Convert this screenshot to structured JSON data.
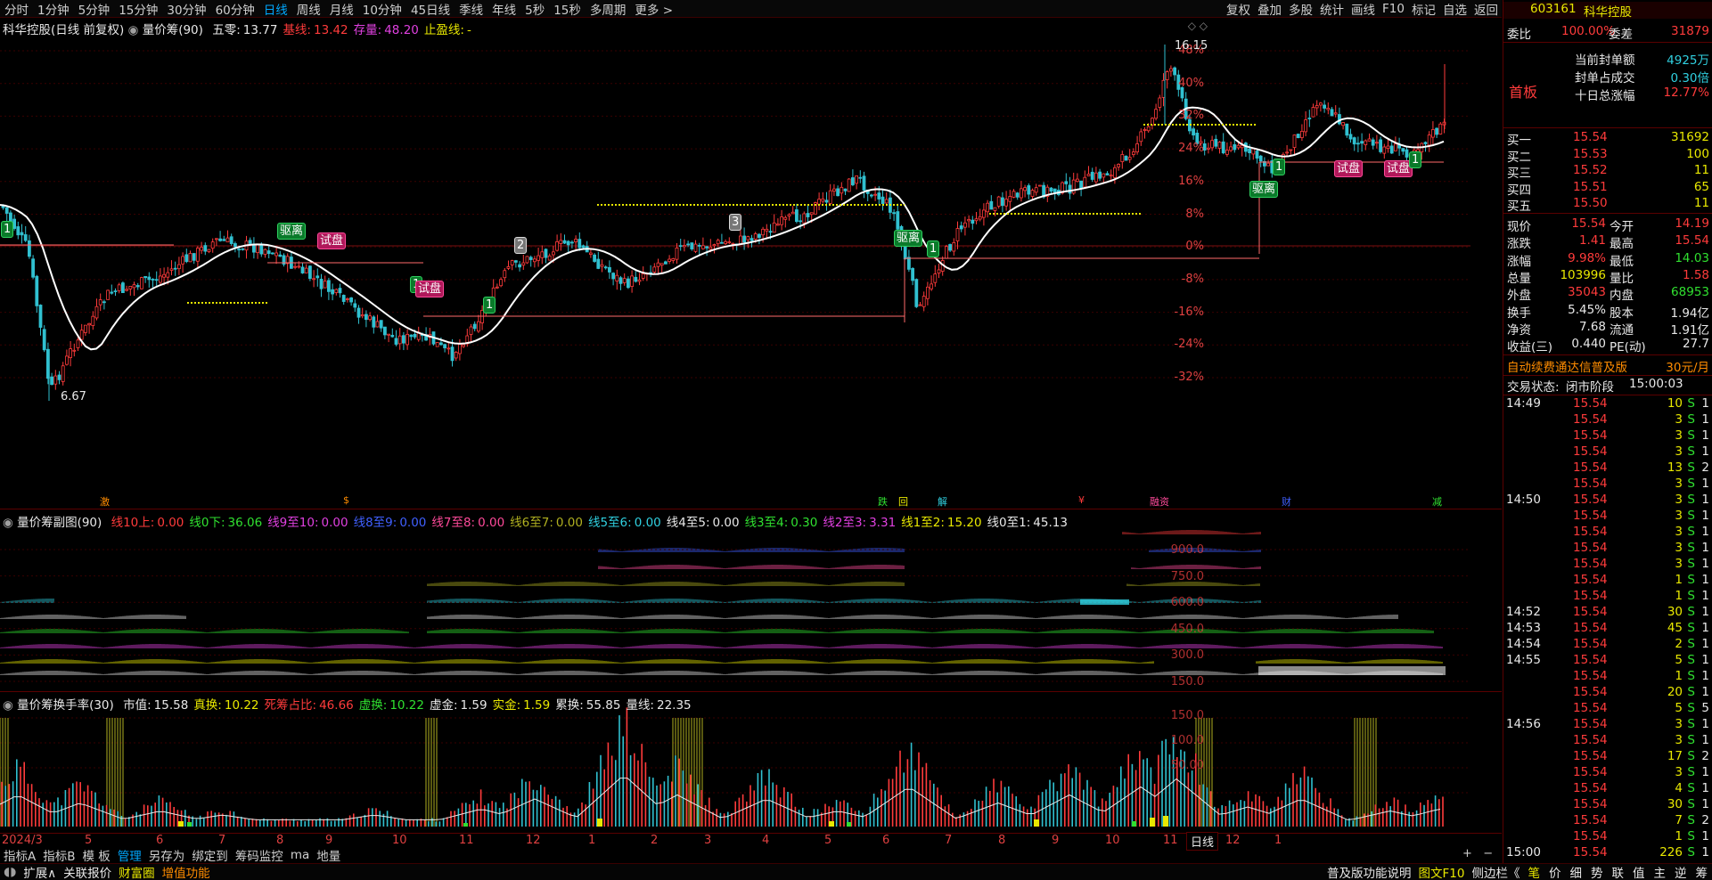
{
  "toolbar": {
    "periods": [
      "分时",
      "1分钟",
      "5分钟",
      "15分钟",
      "30分钟",
      "60分钟",
      "日线",
      "周线",
      "月线",
      "10分钟",
      "45日线",
      "季线",
      "年线",
      "5秒",
      "15秒",
      "多周期",
      "更多 >"
    ],
    "active_period": "日线",
    "right_buttons": [
      "复权",
      "叠加",
      "多股",
      "统计",
      "画线",
      "F10",
      "标记",
      "自选",
      "返回"
    ]
  },
  "main_chart": {
    "stock_label": "科华控股",
    "stock_label_suffix": "(日线 前复权)",
    "indicator_name": "量价筹(90)",
    "indicator_values": [
      {
        "label": "五零:",
        "value": "13.77",
        "color": "#e8e8e8"
      },
      {
        "label": "基线:",
        "value": "13.42",
        "color": "#ff3b3b"
      },
      {
        "label": "存量:",
        "value": "48.20",
        "color": "#e040e0"
      },
      {
        "label": "止盈线:",
        "value": "-",
        "color": "#e8e800"
      }
    ],
    "y_labels": [
      "48%",
      "40%",
      "32%",
      "24%",
      "16%",
      "8%",
      "0%",
      "-8%",
      "-16%",
      "-24%",
      "-32%"
    ],
    "high_label": "16.15",
    "low_label": "6.67",
    "tags": [
      {
        "text": "1",
        "kind": "g"
      },
      {
        "text": "驱离",
        "kind": "g"
      },
      {
        "text": "试盘",
        "kind": "p"
      },
      {
        "text": "1",
        "kind": "g"
      },
      {
        "text": "试盘",
        "kind": "p"
      },
      {
        "text": "1",
        "kind": "g"
      },
      {
        "text": "2",
        "kind": "w"
      },
      {
        "text": "3",
        "kind": "w"
      },
      {
        "text": "驱离",
        "kind": "g"
      },
      {
        "text": "1",
        "kind": "g"
      },
      {
        "text": "驱离",
        "kind": "g"
      },
      {
        "text": "1",
        "kind": "g"
      },
      {
        "text": "试盘",
        "kind": "p"
      },
      {
        "text": "试盘",
        "kind": "p"
      },
      {
        "text": "1",
        "kind": "g"
      }
    ],
    "event_markers": [
      "激",
      "$",
      "跌",
      "回",
      "解",
      "¥",
      "融资",
      "财",
      "减"
    ]
  },
  "sub_chart1": {
    "title": "量价筹副图(90)",
    "values": [
      {
        "label": "线10上:",
        "value": "0.00",
        "color": "#ff3b3b"
      },
      {
        "label": "线0下:",
        "value": "36.06",
        "color": "#30e030"
      },
      {
        "label": "线9至10:",
        "value": "0.00",
        "color": "#e040e0"
      },
      {
        "label": "线8至9:",
        "value": "0.00",
        "color": "#4060ff"
      },
      {
        "label": "线7至8:",
        "value": "0.00",
        "color": "#ff4a9a"
      },
      {
        "label": "线6至7:",
        "value": "0.00",
        "color": "#b0b020"
      },
      {
        "label": "线5至6:",
        "value": "0.00",
        "color": "#30d0e0"
      },
      {
        "label": "线4至5:",
        "value": "0.00",
        "color": "#e8e8e8"
      },
      {
        "label": "线3至4:",
        "value": "0.30",
        "color": "#30e030"
      },
      {
        "label": "线2至3:",
        "value": "3.31",
        "color": "#e040e0"
      },
      {
        "label": "线1至2:",
        "value": "15.20",
        "color": "#e8e800"
      },
      {
        "label": "线0至1:",
        "value": "45.13",
        "color": "#e8e8e8"
      }
    ],
    "y_labels": [
      "900.0",
      "750.0",
      "600.0",
      "450.0",
      "300.0",
      "150.0"
    ]
  },
  "sub_chart2": {
    "title": "量价筹换手率(30)",
    "values": [
      {
        "label": "市值:",
        "value": "15.58",
        "color": "#e8e8e8"
      },
      {
        "label": "真换:",
        "value": "10.22",
        "color": "#e8e800"
      },
      {
        "label": "死筹占比:",
        "value": "46.66",
        "color": "#ff3b3b"
      },
      {
        "label": "虚换:",
        "value": "10.22",
        "color": "#30e030"
      },
      {
        "label": "虚金:",
        "value": "1.59",
        "color": "#e8e8e8"
      },
      {
        "label": "实金:",
        "value": "1.59",
        "color": "#e8e800"
      },
      {
        "label": "累换:",
        "value": "55.85",
        "color": "#e8e8e8"
      },
      {
        "label": "量线:",
        "value": "22.35",
        "color": "#e8e8e8"
      }
    ],
    "y_labels": [
      "150.0",
      "100.0",
      "50.00"
    ]
  },
  "date_axis": {
    "labels": [
      "2024/3",
      "5",
      "6",
      "7",
      "8",
      "9",
      "10",
      "11",
      "12",
      "1",
      "2",
      "3",
      "4",
      "5",
      "6",
      "7",
      "8",
      "9",
      "10",
      "11",
      "12",
      "1"
    ],
    "period_label": "日线"
  },
  "bottom_tabs": [
    "指标A",
    "指标B",
    "模 板",
    "管理",
    "另存为",
    "绑定到",
    "筹码监控",
    "ma",
    "地量"
  ],
  "bottom_tab_selected": "管理",
  "status_bar": {
    "left": [
      "扩展∧",
      "关联报价",
      "财富圈",
      "增值功能"
    ],
    "right_text": "普及版功能说明",
    "right_link": "图文F10",
    "right_more": "侧边栏《",
    "right_tabs": [
      "笔",
      "价",
      "细",
      "势",
      "联",
      "值",
      "主",
      "逆",
      "筹"
    ]
  },
  "panel": {
    "code": "603161",
    "name": "科华控股",
    "weibi_label": "委比",
    "weibi_value": "100.00%",
    "weicha_label": "委差",
    "weicha_value": "31879",
    "limit_label": "首板",
    "seal_amount_label": "当前封单额",
    "seal_amount_value": "4925万",
    "seal_ratio_label": "封单占成交",
    "seal_ratio_value": "0.30倍",
    "ten_day_label": "十日总涨幅",
    "ten_day_value": "12.77%",
    "bids": [
      {
        "label": "买一",
        "price": "15.54",
        "vol": "31692"
      },
      {
        "label": "买二",
        "price": "15.53",
        "vol": "100"
      },
      {
        "label": "买三",
        "price": "15.52",
        "vol": "11"
      },
      {
        "label": "买四",
        "price": "15.51",
        "vol": "65"
      },
      {
        "label": "买五",
        "price": "15.50",
        "vol": "11"
      }
    ],
    "quote": [
      {
        "l1": "现价",
        "v1": "15.54",
        "c1": "red",
        "l2": "今开",
        "v2": "14.19",
        "c2": "red"
      },
      {
        "l1": "涨跌",
        "v1": "1.41",
        "c1": "red",
        "l2": "最高",
        "v2": "15.54",
        "c2": "red"
      },
      {
        "l1": "涨幅",
        "v1": "9.98%",
        "c1": "red",
        "l2": "最低",
        "v2": "14.03",
        "c2": "green"
      },
      {
        "l1": "总量",
        "v1": "103996",
        "c1": "yellow",
        "l2": "量比",
        "v2": "1.58",
        "c2": "red"
      },
      {
        "l1": "外盘",
        "v1": "35043",
        "c1": "red",
        "l2": "内盘",
        "v2": "68953",
        "c2": "green"
      },
      {
        "l1": "换手",
        "v1": "5.45%",
        "c1": "white",
        "l2": "股本",
        "v2": "1.94亿",
        "c2": "white"
      },
      {
        "l1": "净资",
        "v1": "7.68",
        "c1": "white",
        "l2": "流通",
        "v2": "1.91亿",
        "c2": "white"
      },
      {
        "l1": "收益(三)",
        "v1": "0.440",
        "c1": "white",
        "l2": "PE(动)",
        "v2": "27.7",
        "c2": "white"
      }
    ],
    "ad_text": "自动续费通达信普及版",
    "ad_price": "30元/月",
    "trade_status_label": "交易状态:",
    "trade_status_value": "闭市阶段",
    "trade_status_time": "15:00:03",
    "ticks": [
      {
        "t": "14:49",
        "p": "15.54",
        "v": "10",
        "s": "S",
        "n": "1"
      },
      {
        "t": "",
        "p": "15.54",
        "v": "3",
        "s": "S",
        "n": "1"
      },
      {
        "t": "",
        "p": "15.54",
        "v": "3",
        "s": "S",
        "n": "1"
      },
      {
        "t": "",
        "p": "15.54",
        "v": "3",
        "s": "S",
        "n": "1"
      },
      {
        "t": "",
        "p": "15.54",
        "v": "13",
        "s": "S",
        "n": "2"
      },
      {
        "t": "",
        "p": "15.54",
        "v": "3",
        "s": "S",
        "n": "1"
      },
      {
        "t": "14:50",
        "p": "15.54",
        "v": "3",
        "s": "S",
        "n": "1"
      },
      {
        "t": "",
        "p": "15.54",
        "v": "3",
        "s": "S",
        "n": "1"
      },
      {
        "t": "",
        "p": "15.54",
        "v": "3",
        "s": "S",
        "n": "1"
      },
      {
        "t": "",
        "p": "15.54",
        "v": "3",
        "s": "S",
        "n": "1"
      },
      {
        "t": "",
        "p": "15.54",
        "v": "3",
        "s": "S",
        "n": "1"
      },
      {
        "t": "",
        "p": "15.54",
        "v": "1",
        "s": "S",
        "n": "1"
      },
      {
        "t": "",
        "p": "15.54",
        "v": "1",
        "s": "S",
        "n": "1"
      },
      {
        "t": "14:52",
        "p": "15.54",
        "v": "30",
        "s": "S",
        "n": "1"
      },
      {
        "t": "14:53",
        "p": "15.54",
        "v": "45",
        "s": "S",
        "n": "1"
      },
      {
        "t": "14:54",
        "p": "15.54",
        "v": "2",
        "s": "S",
        "n": "1"
      },
      {
        "t": "14:55",
        "p": "15.54",
        "v": "5",
        "s": "S",
        "n": "1"
      },
      {
        "t": "",
        "p": "15.54",
        "v": "1",
        "s": "S",
        "n": "1"
      },
      {
        "t": "",
        "p": "15.54",
        "v": "20",
        "s": "S",
        "n": "1"
      },
      {
        "t": "",
        "p": "15.54",
        "v": "5",
        "s": "S",
        "n": "5"
      },
      {
        "t": "14:56",
        "p": "15.54",
        "v": "3",
        "s": "S",
        "n": "1"
      },
      {
        "t": "",
        "p": "15.54",
        "v": "3",
        "s": "S",
        "n": "1"
      },
      {
        "t": "",
        "p": "15.54",
        "v": "17",
        "s": "S",
        "n": "2"
      },
      {
        "t": "",
        "p": "15.54",
        "v": "3",
        "s": "S",
        "n": "1"
      },
      {
        "t": "",
        "p": "15.54",
        "v": "4",
        "s": "S",
        "n": "1"
      },
      {
        "t": "",
        "p": "15.54",
        "v": "30",
        "s": "S",
        "n": "1"
      },
      {
        "t": "",
        "p": "15.54",
        "v": "7",
        "s": "S",
        "n": "2"
      },
      {
        "t": "",
        "p": "15.54",
        "v": "1",
        "s": "S",
        "n": "1"
      },
      {
        "t": "15:00",
        "p": "15.54",
        "v": "226",
        "s": "S",
        "n": "1"
      }
    ]
  },
  "colors": {
    "up": "#ff3b3b",
    "down": "#30c0d0",
    "ma": "#ffffff",
    "support": "#e8e800",
    "grid": "#3a0000"
  }
}
